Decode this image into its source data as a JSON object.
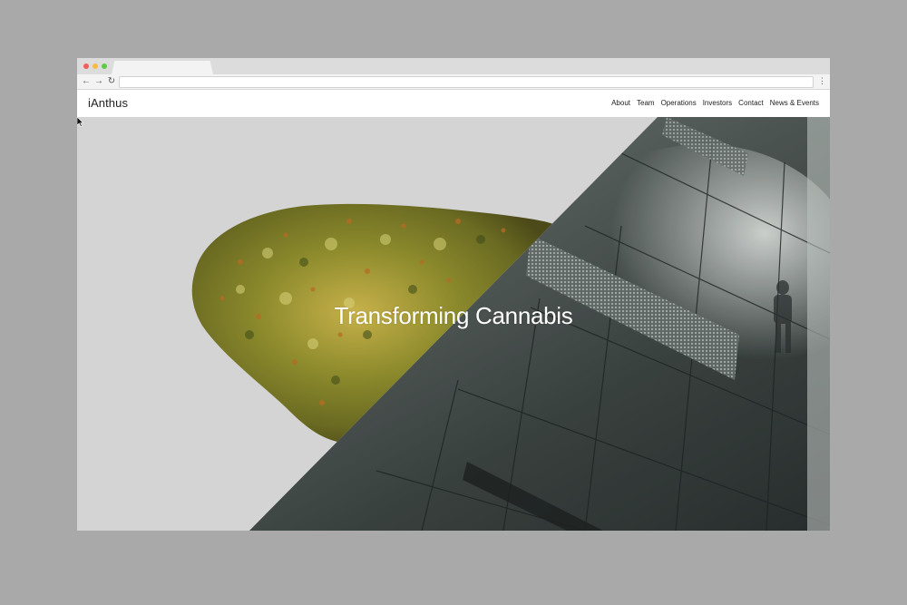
{
  "browser": {
    "back_icon": "back-arrow-icon",
    "forward_icon": "forward-arrow-icon",
    "reload_icon": "reload-icon",
    "menu_icon": "vertical-ellipsis-icon",
    "address_value": ""
  },
  "site": {
    "logo": "iAnthus",
    "nav": [
      "About",
      "Team",
      "Operations",
      "Investors",
      "Contact",
      "News & Events"
    ]
  },
  "hero": {
    "headline": "Transforming Cannabis"
  },
  "colors": {
    "backdrop": "#a9a9a9",
    "hero_left": "#d4d4d4",
    "headline": "#ffffff"
  }
}
